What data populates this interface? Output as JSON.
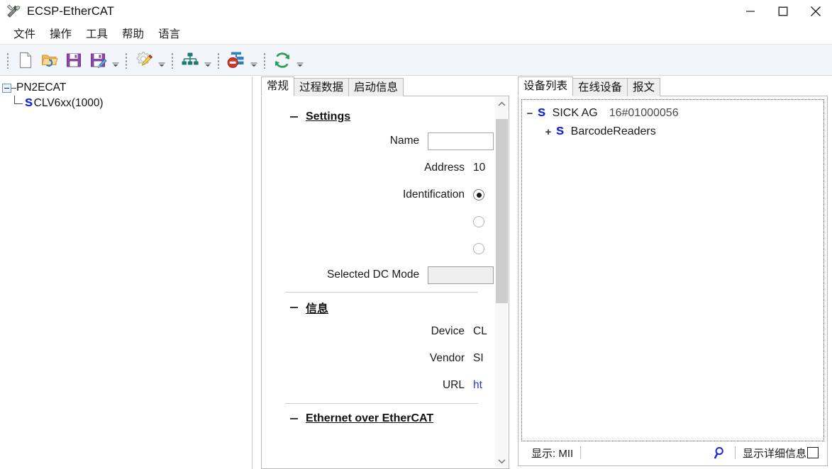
{
  "window": {
    "title": "ECSP-EtherCAT",
    "app_icon": "tools-icon",
    "controls": [
      {
        "name": "minimize-button",
        "glyph": "minimize-icon"
      },
      {
        "name": "maximize-button",
        "glyph": "maximize-icon"
      },
      {
        "name": "close-button",
        "glyph": "close-icon"
      }
    ]
  },
  "menubar": {
    "items": [
      {
        "label": "文件"
      },
      {
        "label": "操作"
      },
      {
        "label": "工具"
      },
      {
        "label": "帮助"
      },
      {
        "label": "语言"
      }
    ]
  },
  "toolbar": {
    "groups": [
      {
        "buttons": [
          {
            "icon": "new-file-icon"
          },
          {
            "icon": "open-folder-icon"
          },
          {
            "icon": "save-icon"
          },
          {
            "icon": "save-as-icon"
          }
        ],
        "has_overflow": true
      },
      {
        "buttons": [
          {
            "icon": "configure-gear-pencil-icon"
          }
        ],
        "has_overflow": true
      },
      {
        "buttons": [
          {
            "icon": "network-topology-icon"
          }
        ],
        "has_overflow": true
      },
      {
        "buttons": [
          {
            "icon": "stop-process-data-icon"
          }
        ],
        "has_overflow": true
      },
      {
        "buttons": [
          {
            "icon": "refresh-icon"
          }
        ],
        "has_overflow": true
      }
    ]
  },
  "left_tree": {
    "root": {
      "label": "PN2ECAT",
      "expanded": true
    },
    "child": {
      "label": "CLV6xx(1000)",
      "badge": "S"
    }
  },
  "center": {
    "tabs": [
      {
        "label": "常规",
        "active": true
      },
      {
        "label": "过程数据",
        "active": false
      },
      {
        "label": "启动信息",
        "active": false
      }
    ],
    "sections": [
      {
        "title": "Settings",
        "rows": [
          {
            "label": "Name",
            "type": "textbox",
            "value": ""
          },
          {
            "label": "Address",
            "type": "text",
            "value": "10"
          },
          {
            "label": "Identification",
            "type": "radio",
            "checked": true
          },
          {
            "label": "",
            "type": "radio",
            "checked": false
          },
          {
            "label": "",
            "type": "radio",
            "checked": false
          },
          {
            "label": "Selected DC Mode",
            "type": "combobox",
            "value": ""
          }
        ]
      },
      {
        "title": "信息",
        "rows": [
          {
            "label": "Device",
            "type": "text",
            "value": "CL"
          },
          {
            "label": "Vendor",
            "type": "text",
            "value": "SI"
          },
          {
            "label": "URL",
            "type": "link",
            "value": "ht"
          }
        ]
      },
      {
        "title": "Ethernet over EtherCAT",
        "rows": []
      }
    ],
    "scrollbar": {
      "up_arrow": "chevron-up-icon",
      "down_arrow": "chevron-down-icon"
    }
  },
  "right": {
    "tabs": [
      {
        "label": "设备列表",
        "active": true
      },
      {
        "label": "在线设备",
        "active": false
      },
      {
        "label": "报文",
        "active": false
      }
    ],
    "device_tree": [
      {
        "toggle": "−",
        "badge": "S",
        "name": "SICK AG",
        "id": "16#01000056",
        "indent": 0
      },
      {
        "toggle": "+",
        "badge": "S",
        "name": "BarcodeReaders",
        "id": "",
        "indent": 1
      }
    ],
    "statusbar": {
      "display_label": "显示: MII",
      "search_icon": "search-icon",
      "detail_label": "显示详细信息",
      "detail_checked": false
    }
  },
  "colors": {
    "toolbar_bg": "#f2f6fb",
    "accent_blue": "#1826e0",
    "link": "#2c35d8",
    "border": "#b8b8b8"
  }
}
